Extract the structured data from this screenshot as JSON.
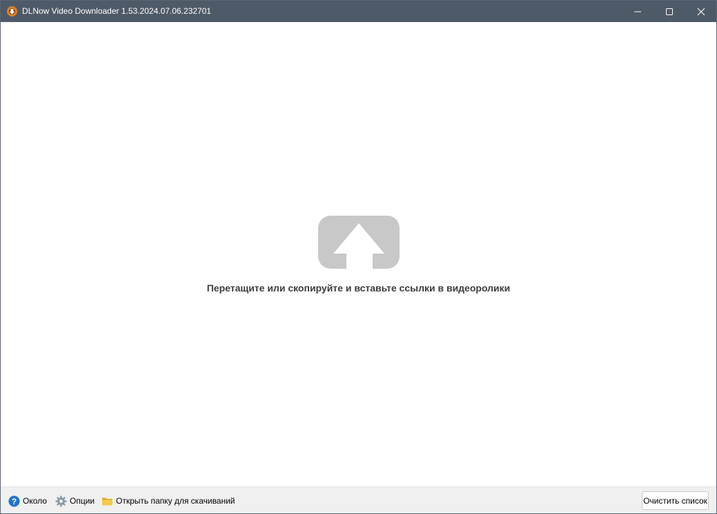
{
  "window": {
    "title": "DLNow Video Downloader 1.53.2024.07.06.232701",
    "app_icon": "dlnow-app-icon",
    "controls": {
      "minimize_icon": "minimize-icon",
      "maximize_icon": "maximize-icon",
      "close_icon": "close-icon"
    }
  },
  "main": {
    "drop_icon": "upload-arrow-icon",
    "drop_hint": "Перетащите или скопируйте и вставьте ссылки в видеоролики"
  },
  "bottom_bar": {
    "about": {
      "icon": "help-icon",
      "label": "Около"
    },
    "options": {
      "icon": "gear-icon",
      "label": "Опции"
    },
    "open_folder": {
      "icon": "folder-icon",
      "label": "Открыть папку для скачиваний"
    },
    "clear_list": {
      "label": "Очистить список"
    }
  },
  "colors": {
    "titlebar": "#4f5a68",
    "drop_icon": "#c8c8c8",
    "bottom_bar": "#f0f0f0",
    "help_icon": "#1f74c8",
    "folder_icon": "#f2c34a"
  }
}
